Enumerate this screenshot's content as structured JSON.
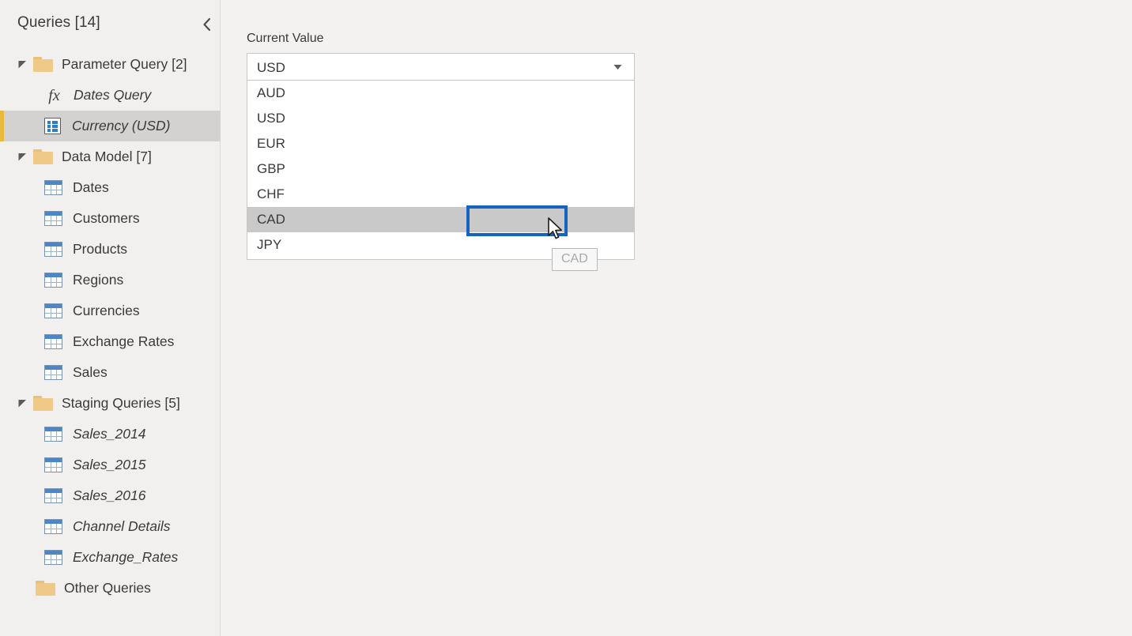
{
  "sidebar": {
    "title": "Queries [14]",
    "collapse_icon": "chevron-left-icon",
    "groups": [
      {
        "label": "Parameter Query [2]",
        "icon": "folder-icon",
        "expanded": true,
        "children": [
          {
            "label": "Dates Query",
            "icon": "fx-icon",
            "italic": true,
            "selected": false
          },
          {
            "label": "Currency (USD)",
            "icon": "parameter-icon",
            "italic": true,
            "selected": true
          }
        ]
      },
      {
        "label": "Data Model [7]",
        "icon": "folder-icon",
        "expanded": true,
        "children": [
          {
            "label": "Dates",
            "icon": "table-icon",
            "italic": false,
            "selected": false
          },
          {
            "label": "Customers",
            "icon": "table-icon",
            "italic": false,
            "selected": false
          },
          {
            "label": "Products",
            "icon": "table-icon",
            "italic": false,
            "selected": false
          },
          {
            "label": "Regions",
            "icon": "table-icon",
            "italic": false,
            "selected": false
          },
          {
            "label": "Currencies",
            "icon": "table-icon",
            "italic": false,
            "selected": false
          },
          {
            "label": "Exchange Rates",
            "icon": "table-icon",
            "italic": false,
            "selected": false
          },
          {
            "label": "Sales",
            "icon": "table-icon",
            "italic": false,
            "selected": false
          }
        ]
      },
      {
        "label": "Staging Queries [5]",
        "icon": "folder-icon",
        "expanded": true,
        "children": [
          {
            "label": "Sales_2014",
            "icon": "table-icon",
            "italic": true,
            "selected": false
          },
          {
            "label": "Sales_2015",
            "icon": "table-icon",
            "italic": true,
            "selected": false
          },
          {
            "label": "Sales_2016",
            "icon": "table-icon",
            "italic": true,
            "selected": false
          },
          {
            "label": "Channel Details",
            "icon": "table-icon",
            "italic": true,
            "selected": false
          },
          {
            "label": "Exchange_Rates",
            "icon": "table-icon",
            "italic": true,
            "selected": false
          }
        ]
      }
    ],
    "other_queries": {
      "label": "Other Queries",
      "icon": "folder-icon"
    }
  },
  "main": {
    "current_value_label": "Current Value",
    "combobox": {
      "value": "USD",
      "caret_icon": "chevron-down-icon",
      "options": [
        "AUD",
        "USD",
        "EUR",
        "GBP",
        "CHF",
        "CAD",
        "JPY"
      ],
      "highlighted_option": "CAD"
    },
    "tooltip": {
      "text": "CAD"
    },
    "cursor_icon": "mouse-pointer-icon"
  },
  "colors": {
    "sidebar_bg": "#f1f0ee",
    "main_bg": "#f3f2f0",
    "selection_bg": "#d4d2d0",
    "selection_accent": "#e8b93a",
    "folder": "#eec987",
    "table_header": "#4a86c8",
    "option_highlight": "#c9c9c9",
    "annotation": "#1565c0",
    "text": "#3a3a3a"
  }
}
